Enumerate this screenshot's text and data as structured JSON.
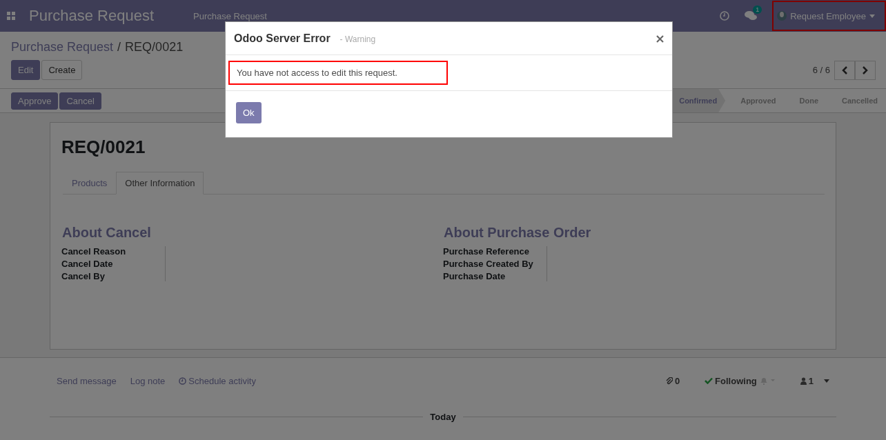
{
  "navbar": {
    "app_title": "Purchase Request",
    "menu": [
      "Purchase Request"
    ],
    "messages_count": "1",
    "user": "Request Employee",
    "user_highlighted": true
  },
  "breadcrumb": {
    "parent": "Purchase Request",
    "separator": "/",
    "current": "REQ/0021"
  },
  "actions": [
    "Edit",
    "Create"
  ],
  "pager": {
    "text": "6 / 6"
  },
  "status_buttons": [
    "Approve",
    "Cancel"
  ],
  "stages": [
    {
      "label": "Confirmed",
      "selected": true
    },
    {
      "label": "Approved",
      "selected": false
    },
    {
      "label": "Done",
      "selected": false
    },
    {
      "label": "Cancelled",
      "selected": false
    }
  ],
  "record": {
    "title": "REQ/0021",
    "tabs": [
      {
        "label": "Products",
        "selected": false
      },
      {
        "label": "Other Information",
        "selected": true
      }
    ],
    "groups": [
      {
        "title": "About Cancel",
        "fields": [
          "Cancel Reason",
          "Cancel Date",
          "Cancel By"
        ]
      },
      {
        "title": "About Purchase Order",
        "fields": [
          "Purchase Reference",
          "Purchase Created By",
          "Purchase Date"
        ]
      }
    ]
  },
  "chatter": {
    "actions": [
      "Send message",
      "Log note",
      "Schedule activity"
    ],
    "attachments": "0",
    "follow": "Following",
    "followers": "1",
    "separator": "Today"
  },
  "dialog": {
    "title": "Odoo Server Error",
    "subtitle": "- Warning",
    "message": "You have not access to edit this request.",
    "message_highlighted": true,
    "button": "Ok"
  }
}
